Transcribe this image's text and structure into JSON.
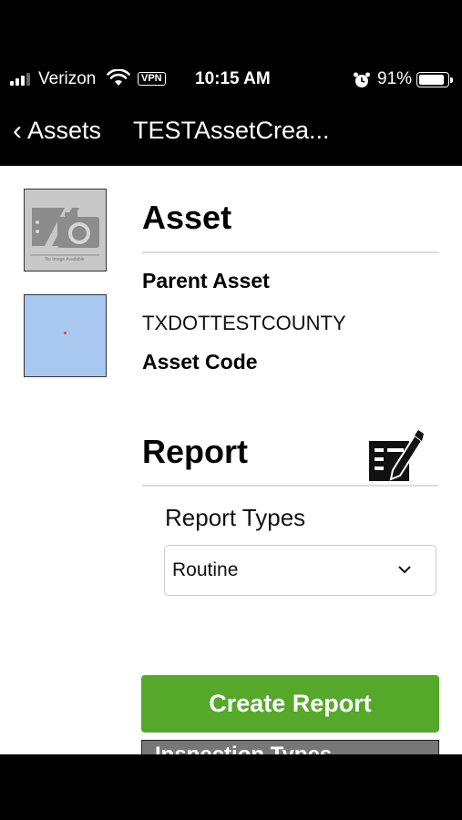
{
  "status_bar": {
    "carrier": "Verizon",
    "vpn": "VPN",
    "time": "10:15 AM",
    "battery": "91%",
    "battery_level": 0.91,
    "icons": [
      "signal-icon",
      "wifi-icon",
      "alarm-icon",
      "battery-icon"
    ]
  },
  "nav": {
    "back_label": "Assets",
    "title": "TESTAssetCrea..."
  },
  "thumbnails": {
    "no_image_text": "No Image Available"
  },
  "asset": {
    "heading": "Asset",
    "parent_label": "Parent Asset",
    "parent_value": "TXDOTTESTCOUNTY",
    "code_label": "Asset Code"
  },
  "report": {
    "heading": "Report",
    "types_label": "Report Types",
    "selected_type": "Routine",
    "create_button": "Create Report",
    "inspection_types": "Inspection Types"
  },
  "colors": {
    "accent_green": "#56a82a",
    "map_blue": "#a9c8ef"
  }
}
